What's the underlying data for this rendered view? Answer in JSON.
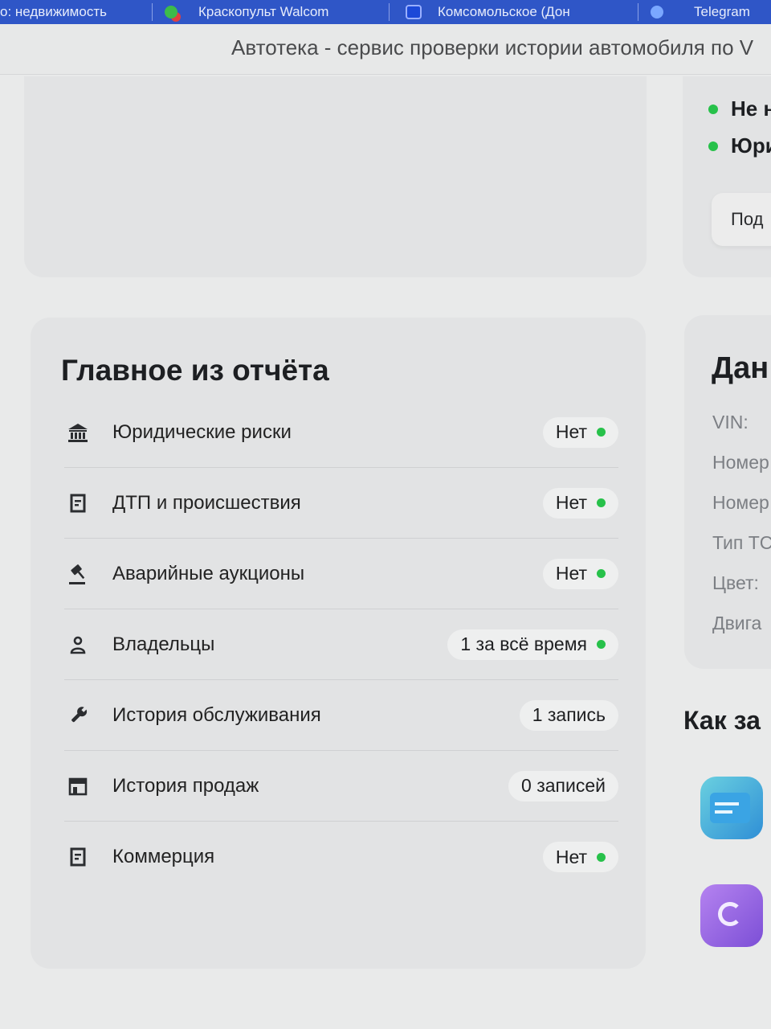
{
  "browser": {
    "tabs": [
      {
        "label": "о: недвижимость",
        "icon": "page-icon"
      },
      {
        "label": "Краскопульт Walcom",
        "icon": "site-icon"
      },
      {
        "label": "Комсомольское (Дон",
        "icon": "map-icon"
      },
      {
        "label": "Telegram",
        "icon": "telegram-icon"
      }
    ],
    "page_title": "Автотека - сервис проверки истории автомобиля по V"
  },
  "top_right": {
    "bullets": [
      "Не н",
      "Юри"
    ],
    "button_label": "Под"
  },
  "report": {
    "title": "Главное из отчёта",
    "rows": [
      {
        "icon": "bank-icon",
        "label": "Юридические риски",
        "value": "Нет",
        "status": "ok"
      },
      {
        "icon": "document-icon",
        "label": "ДТП и происшествия",
        "value": "Нет",
        "status": "ok"
      },
      {
        "icon": "gavel-icon",
        "label": "Аварийные аукционы",
        "value": "Нет",
        "status": "ok"
      },
      {
        "icon": "person-icon",
        "label": "Владельцы",
        "value": "1 за всё время",
        "status": "ok"
      },
      {
        "icon": "wrench-icon",
        "label": "История обслуживания",
        "value": "1 запись",
        "status": "none"
      },
      {
        "icon": "storefront-icon",
        "label": "История продаж",
        "value": "0 записей",
        "status": "none"
      },
      {
        "icon": "document-icon",
        "label": "Коммерция",
        "value": "Нет",
        "status": "ok"
      }
    ]
  },
  "vehicle_data": {
    "title": "Дан",
    "fields": [
      "VIN:",
      "Номер",
      "Номер",
      "Тип ТС",
      "Цвет:",
      "Двига"
    ]
  },
  "how_to": {
    "title": "Как за"
  },
  "colors": {
    "ok_dot": "#27c14a",
    "tab_bar": "#2f56c7"
  }
}
